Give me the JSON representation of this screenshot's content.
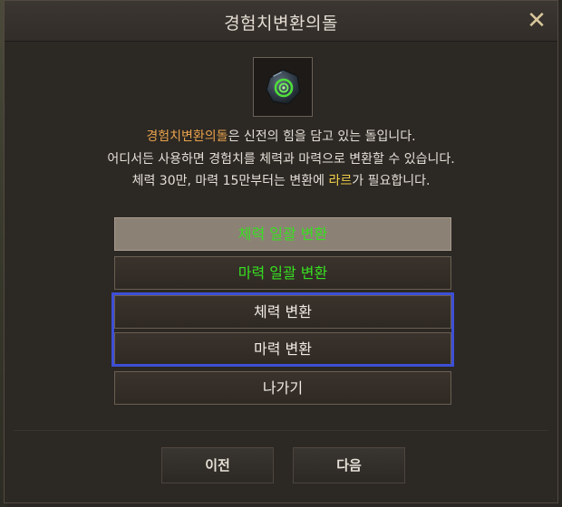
{
  "dialog": {
    "title": "경험치변환의돌",
    "close_glyph": "✕"
  },
  "item": {
    "icon": "gem-icon",
    "colors": {
      "stone": "#2f3b46",
      "glow": "#4fe03a"
    }
  },
  "description": {
    "line1_item": "경험치변환의돌",
    "line1_rest": "은 신전의 힘을 담고 있는 돌입니다.",
    "line2": "어디서든 사용하면 경험치를 체력과 마력으로 변환할 수 있습니다.",
    "line3_before": "체력 30만, 마력 15만부터는 변환에 ",
    "line3_currency": "라르",
    "line3_after": "가 필요합니다."
  },
  "options": [
    {
      "label": "체력 일괄 변환"
    },
    {
      "label": "마력 일괄 변환"
    },
    {
      "label": "체력 변환"
    },
    {
      "label": "마력 변환"
    },
    {
      "label": "나가기"
    }
  ],
  "footer": {
    "prev_label": "이전",
    "next_label": "다음"
  },
  "colors": {
    "highlight_orange": "#e8a24b",
    "highlight_yellow": "#f0d04a",
    "bulk_green": "#37e020",
    "selection_blue": "#3d4fd6"
  }
}
